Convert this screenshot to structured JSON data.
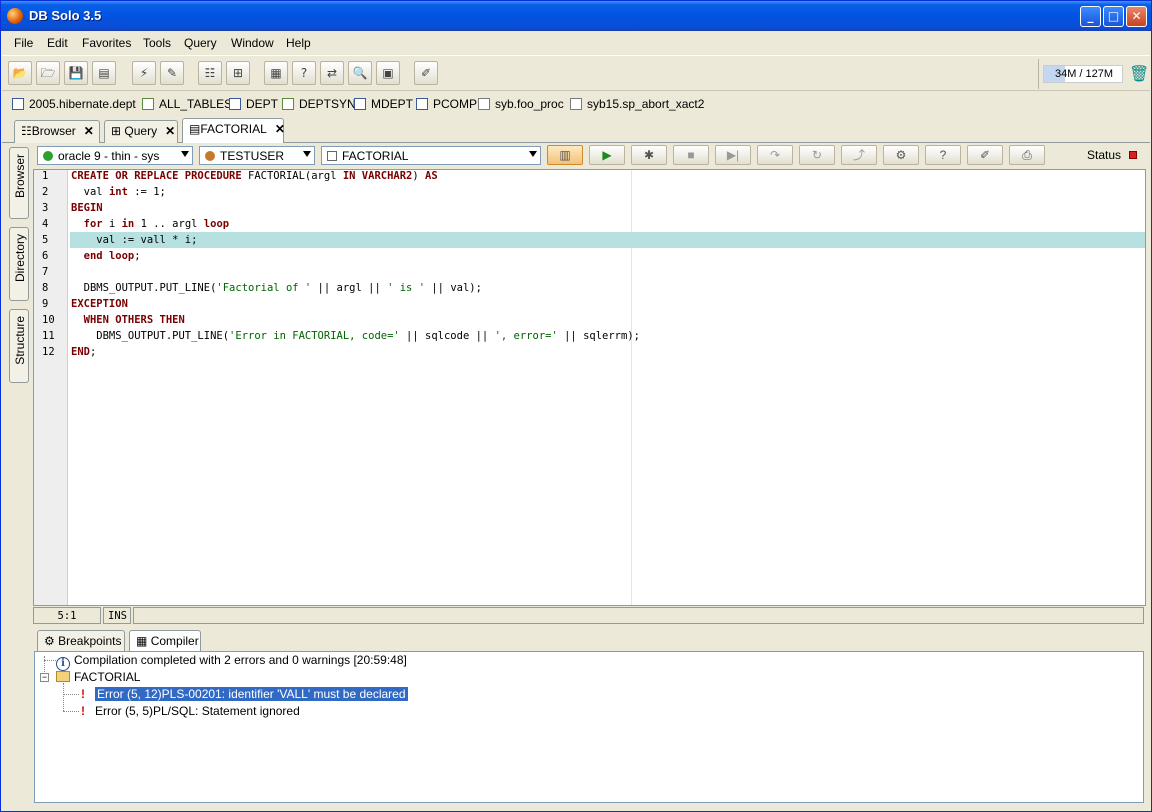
{
  "window": {
    "title": "DB Solo  3.5"
  },
  "menu": [
    "File",
    "Edit",
    "Favorites",
    "Tools",
    "Query",
    "Window",
    "Help"
  ],
  "memory": {
    "label": "34M / 127M",
    "used_fraction": 0.27
  },
  "favorites": [
    "2005.hibernate.dept",
    "ALL_TABLES",
    "DEPT",
    "DEPTSYN",
    "MDEPT",
    "PCOMP",
    "syb.foo_proc",
    "syb15.sp_abort_xact2"
  ],
  "tabs": [
    "Browser",
    "Query",
    "FACTORIAL"
  ],
  "side_tabs": [
    "Browser",
    "Directory",
    "Structure"
  ],
  "connection": {
    "server": "oracle 9 - thin - sys",
    "user": "TESTUSER",
    "object": "FACTORIAL",
    "status_label": "Status"
  },
  "editor": {
    "line_numbers": [
      "1",
      "2",
      "3",
      "4",
      "5",
      "6",
      "7",
      "8",
      "9",
      "10",
      "11",
      "12"
    ],
    "current_line": 5,
    "cursor": "5:1",
    "mode": "INS"
  },
  "bottom_tabs": [
    "Breakpoints",
    "Compiler"
  ],
  "compiler": {
    "summary": "Compilation completed with 2 errors and 0 warnings [20:59:48]",
    "node": "FACTORIAL",
    "errors": [
      "Error (5, 12)PLS-00201: identifier 'VALL' must be declared",
      "Error (5, 5)PL/SQL: Statement ignored"
    ]
  }
}
